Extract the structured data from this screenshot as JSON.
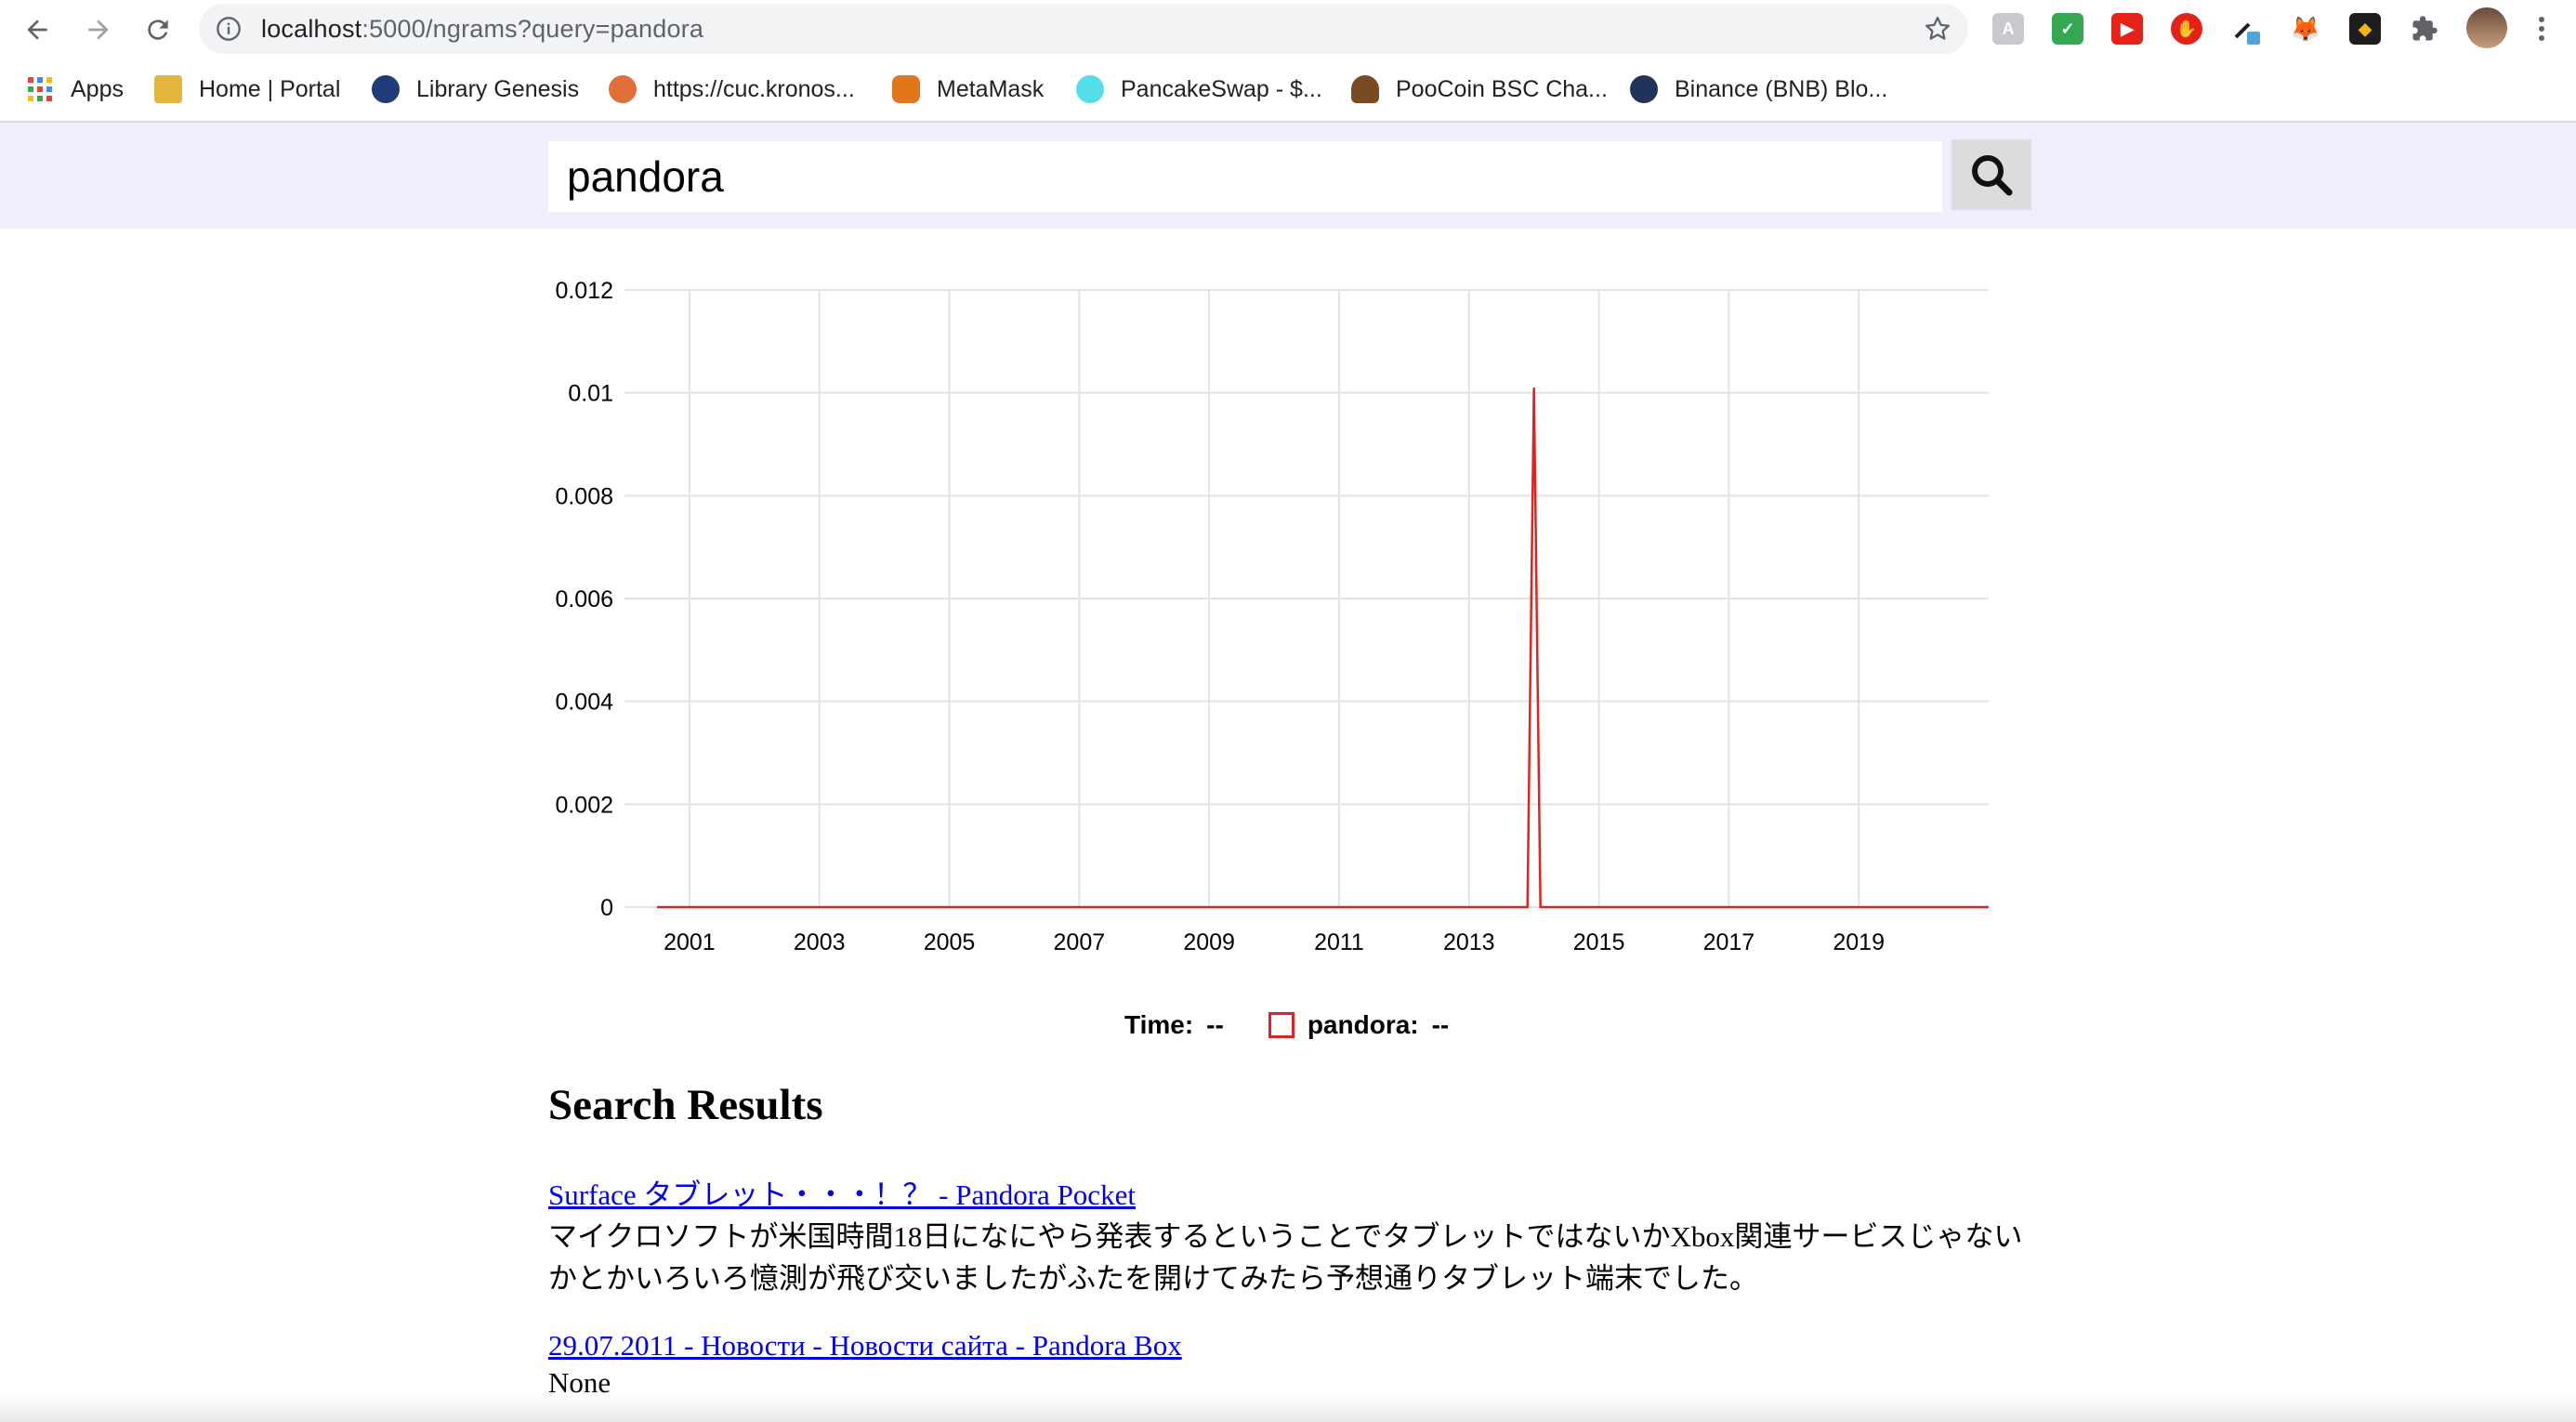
{
  "browser": {
    "url_host": "localhost",
    "url_path": ":5000/ngrams?query=pandora",
    "bookmarks": [
      {
        "label": "Apps",
        "icon": "apps-grid-icon"
      },
      {
        "label": "Home | Portal",
        "icon": "folder-icon"
      },
      {
        "label": "Library Genesis",
        "icon": "library-genesis-icon"
      },
      {
        "label": "https://cuc.kronos...",
        "icon": "kronos-icon"
      },
      {
        "label": "MetaMask",
        "icon": "metamask-fox-icon"
      },
      {
        "label": "PancakeSwap - $...",
        "icon": "pancakeswap-bunny-icon"
      },
      {
        "label": "PooCoin BSC Cha...",
        "icon": "poocoin-icon"
      },
      {
        "label": "Binance (BNB) Blo...",
        "icon": "bscscan-icon"
      }
    ],
    "extensions": [
      "translate-ext-icon",
      "mail-check-ext-icon",
      "youtube-ext-icon",
      "adblock-hand-ext-icon",
      "eyedropper-ext-icon",
      "metamask-ext-icon",
      "binance-ext-icon",
      "puzzle-extensions-icon",
      "profile-avatar",
      "kebab-menu-icon"
    ]
  },
  "search": {
    "query": "pandora"
  },
  "chart_data": {
    "type": "line",
    "title": "",
    "xlabel": "",
    "ylabel": "",
    "x_ticks": [
      "2001",
      "2003",
      "2005",
      "2007",
      "2009",
      "2011",
      "2013",
      "2015",
      "2017",
      "2019"
    ],
    "y_ticks": [
      "0",
      "0.002",
      "0.004",
      "0.006",
      "0.008",
      "0.01",
      "0.012"
    ],
    "xlim": [
      2000,
      2021
    ],
    "ylim": [
      0,
      0.012
    ],
    "grid": true,
    "series": [
      {
        "name": "pandora",
        "color": "#e0231e",
        "x": [
          2000.5,
          2012.9,
          2013.9,
          2014.0,
          2014.1,
          2015.0,
          2021.0
        ],
        "y": [
          0,
          0,
          0,
          0.0101,
          0,
          0,
          0
        ]
      }
    ]
  },
  "legend": {
    "time_label": "Time:",
    "time_value": "--",
    "series_label": "pandora:",
    "series_value": "--"
  },
  "results": {
    "title": "Search Results",
    "items": [
      {
        "link": "Surface タブレット・・・！？ - Pandora Pocket",
        "description": "マイクロソフトが米国時間18日になにやら発表するということでタブレットではないかXbox関連サービスじゃないかとかいろいろ憶測が飛び交いましたがふたを開けてみたら予想通りタブレット端末でした。"
      },
      {
        "link": "29.07.2011 - Новости - Новости сайта - Pandora Box",
        "description": "None"
      }
    ]
  }
}
